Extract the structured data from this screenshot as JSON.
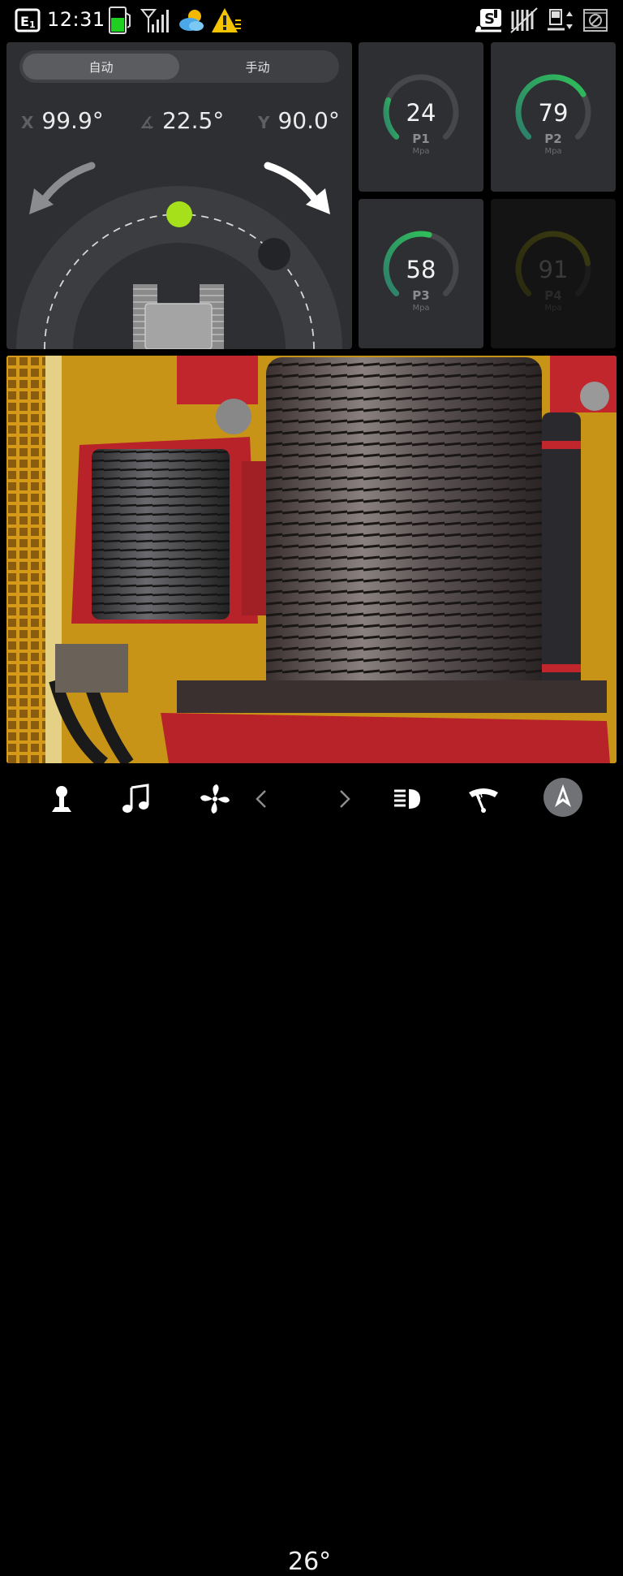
{
  "status_bar": {
    "time": "12:31",
    "icons": [
      "engine-e1-icon",
      "fuel-icon",
      "signal-icon",
      "weather-icon",
      "warning-icon",
      "mode-s-icon",
      "wiper-icon",
      "hydraulic-icon",
      "camera-off-icon"
    ]
  },
  "mode": {
    "auto_label": "自动",
    "manual_label": "手动",
    "selected": "auto"
  },
  "angles": {
    "x": {
      "label": "X",
      "value": "99.9°"
    },
    "tilt": {
      "label": "∡",
      "value": "22.5°"
    },
    "y": {
      "label": "Y",
      "value": "90.0°"
    }
  },
  "gauges": [
    {
      "name": "P1",
      "value": "24",
      "unit": "Mpa",
      "fraction": 0.24,
      "color": "#2fbf5a"
    },
    {
      "name": "P2",
      "value": "79",
      "unit": "Mpa",
      "fraction": 0.72,
      "color": "#2fbf5a"
    },
    {
      "name": "P3",
      "value": "58",
      "unit": "Mpa",
      "fraction": 0.55,
      "color": "#2fbf5a"
    },
    {
      "name": "P4",
      "value": "91",
      "unit": "Mpa",
      "fraction": 0.8,
      "color": "#3a3a10"
    }
  ],
  "bottom_bar": {
    "temperature": "26°",
    "icons": [
      "joystick-icon",
      "music-icon",
      "fan-icon",
      "chevron-left-icon",
      "chevron-right-icon",
      "headlight-icon",
      "wiper-icon",
      "home-logo-icon"
    ]
  },
  "colors": {
    "accent_green": "#2fbf5a",
    "indicator_lime": "#a6e01a",
    "panel_bg": "#2d2f32"
  }
}
